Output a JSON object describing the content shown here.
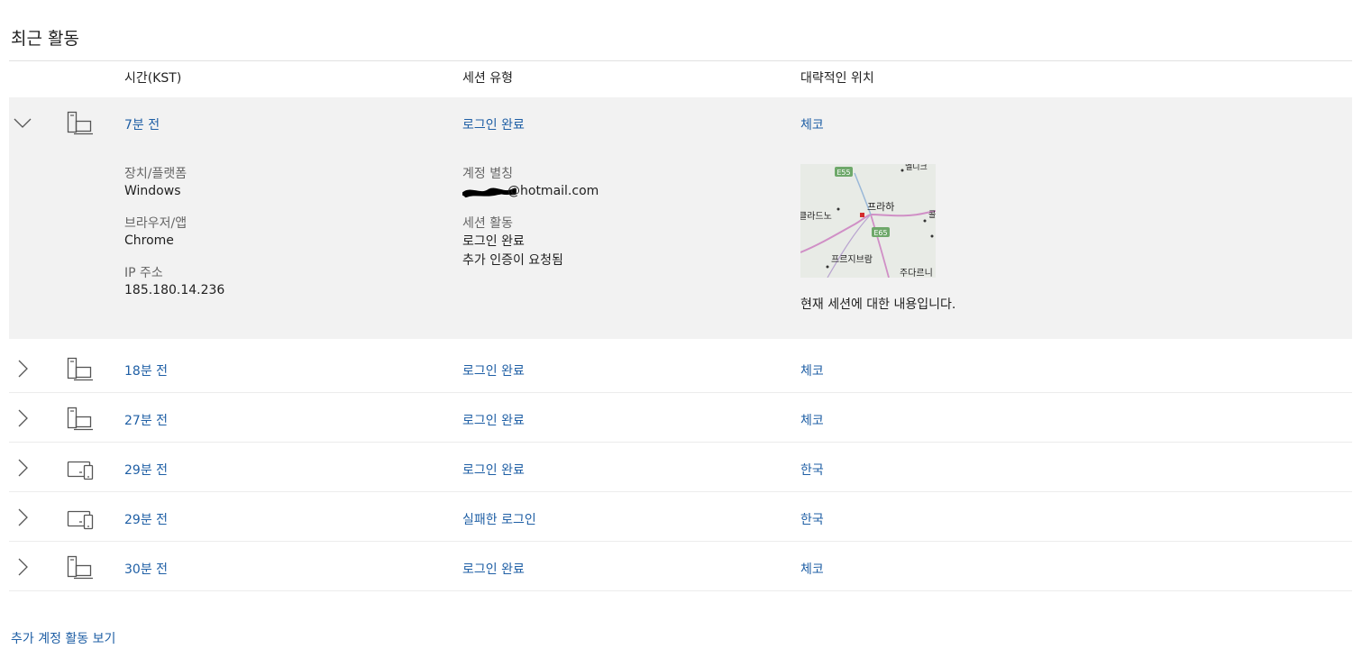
{
  "title": "최근 활동",
  "columns": {
    "time": "시간(KST)",
    "session_type": "세션 유형",
    "location": "대략적인 위치"
  },
  "rows": [
    {
      "time": "7분 전",
      "session": "로그인 완료",
      "location": "체코",
      "device": "desktop"
    },
    {
      "time": "18분 전",
      "session": "로그인 완료",
      "location": "체코",
      "device": "desktop"
    },
    {
      "time": "27분 전",
      "session": "로그인 완료",
      "location": "체코",
      "device": "desktop"
    },
    {
      "time": "29분 전",
      "session": "로그인 완료",
      "location": "한국",
      "device": "multi-device"
    },
    {
      "time": "29분 전",
      "session": "실패한 로그인",
      "location": "한국",
      "device": "multi-device"
    },
    {
      "time": "30분 전",
      "session": "로그인 완료",
      "location": "체코",
      "device": "desktop"
    }
  ],
  "detail": {
    "device_label": "장치/플랫폼",
    "device_value": "Windows",
    "browser_label": "브라우저/앱",
    "browser_value": "Chrome",
    "ip_label": "IP 주소",
    "ip_value": "185.180.14.236",
    "alias_label": "계정 별칭",
    "alias_value": "@hotmail.com",
    "activity_label": "세션 활동",
    "activity_line1": "로그인 완료",
    "activity_line2": "추가 인증이 요청됨",
    "map_caption": "현재 세션에 대한 내용입니다.",
    "map_labels": {
      "city": "프라하",
      "west": "클라드노",
      "south": "프르지브람",
      "southeast": "주다르니",
      "north": "멜니크",
      "east": "콜",
      "road1": "E55",
      "road2": "E65"
    }
  },
  "more_link": "추가 계정 활동 보기",
  "colors": {
    "link": "#1f5fa5",
    "row_bg": "#f2f2f2",
    "divider": "#ececec"
  },
  "icons": {
    "expanded": "chevron-down-icon",
    "collapsed": "chevron-right-icon",
    "desktop": "desktop-pc-icon",
    "multi": "laptop-phone-icon"
  }
}
